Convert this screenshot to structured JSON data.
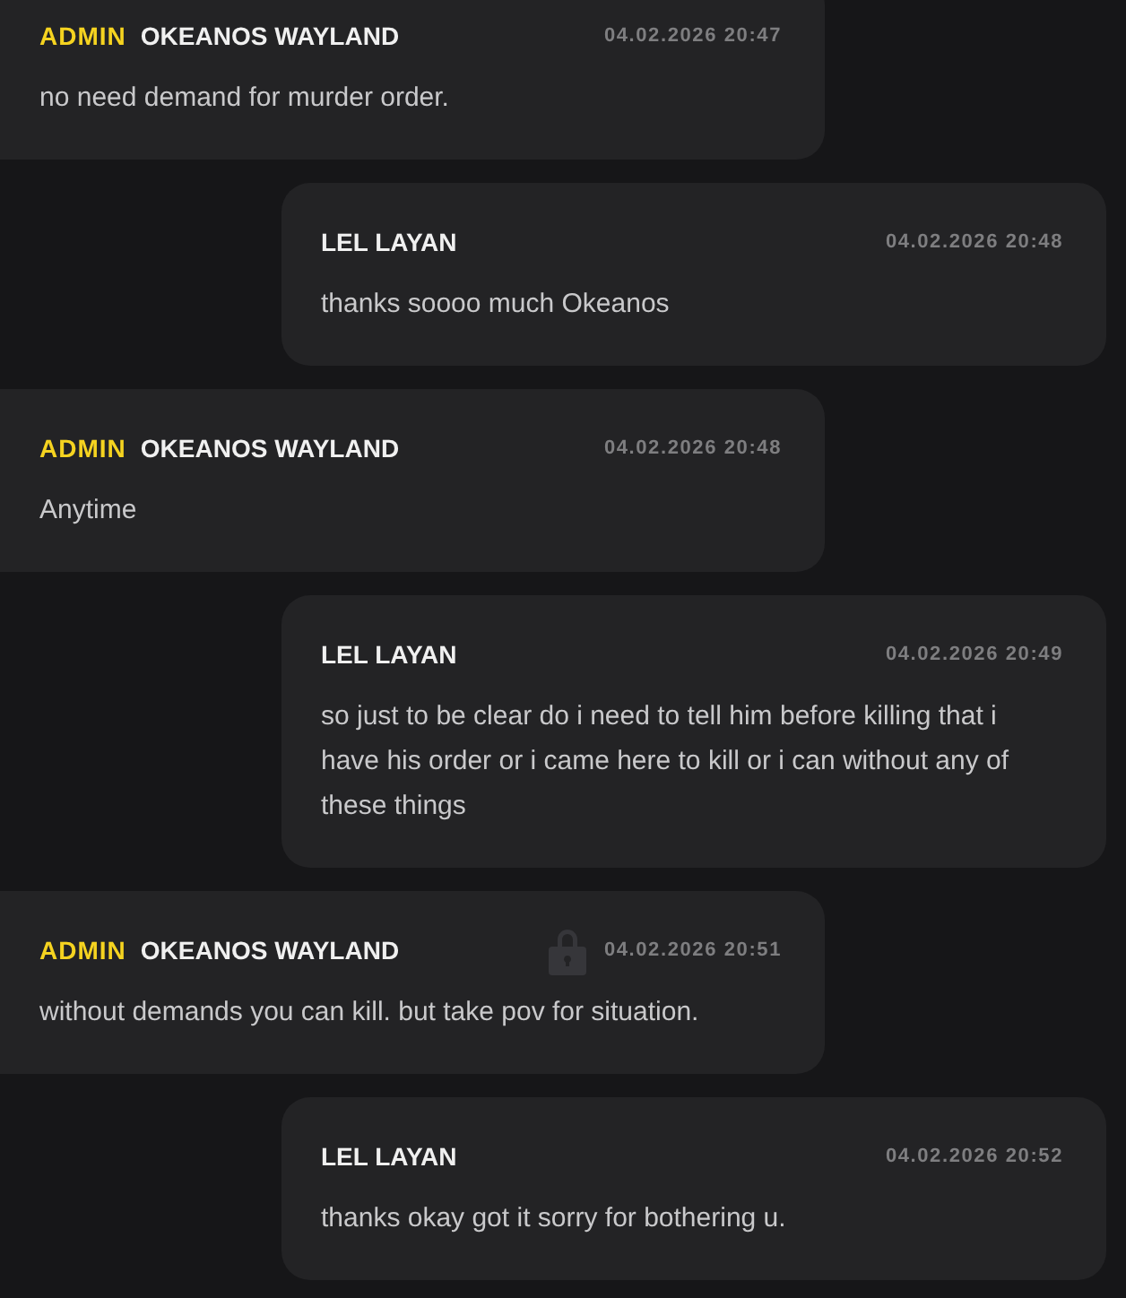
{
  "messages": [
    {
      "kind": "admin",
      "role_label": "ADMIN",
      "author": "OKEANOS WAYLAND",
      "time": "04.02.2026 20:47",
      "text": "no need demand for murder order."
    },
    {
      "kind": "user",
      "author": "LEL LAYAN",
      "time": "04.02.2026 20:48",
      "text": "thanks soooo much Okeanos"
    },
    {
      "kind": "admin",
      "role_label": "ADMIN",
      "author": "OKEANOS WAYLAND",
      "time": "04.02.2026 20:48",
      "text": "Anytime"
    },
    {
      "kind": "user",
      "author": "LEL LAYAN",
      "time": "04.02.2026 20:49",
      "text": "so just to be clear do i need to tell him before killing that i have his order or i came here to kill or i can without any of these things"
    },
    {
      "kind": "admin",
      "role_label": "ADMIN",
      "author": "OKEANOS WAYLAND",
      "time": "04.02.2026 20:51",
      "text": "without demands you can kill. but take pov for situation."
    },
    {
      "kind": "user",
      "author": "LEL LAYAN",
      "time": "04.02.2026 20:52",
      "text": "thanks okay got it sorry for bothering u."
    }
  ]
}
